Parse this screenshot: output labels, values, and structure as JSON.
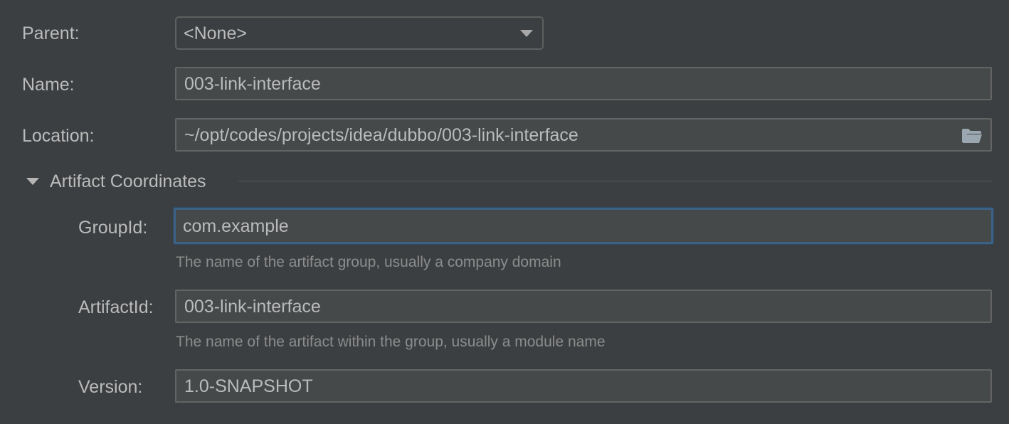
{
  "form": {
    "parent": {
      "label": "Parent:",
      "value": "<None>"
    },
    "name": {
      "label": "Name:",
      "value": "003-link-interface"
    },
    "location": {
      "label": "Location:",
      "value": "~/opt/codes/projects/idea/dubbo/003-link-interface",
      "icon": "folder-icon"
    }
  },
  "artifact": {
    "section_title": "Artifact Coordinates",
    "group_id": {
      "label": "GroupId:",
      "value": "com.example",
      "hint": "The name of the artifact group, usually a company domain"
    },
    "artifact_id": {
      "label": "ArtifactId:",
      "value": "003-link-interface",
      "hint": "The name of the artifact within the group, usually a module name"
    },
    "version": {
      "label": "Version:",
      "value": "1.0-SNAPSHOT"
    }
  },
  "colors": {
    "background": "#3c3f41",
    "field_background": "#45494a",
    "focus_border": "#3d6185",
    "text": "#bbbbbb",
    "hint_text": "#8c8c8c"
  }
}
